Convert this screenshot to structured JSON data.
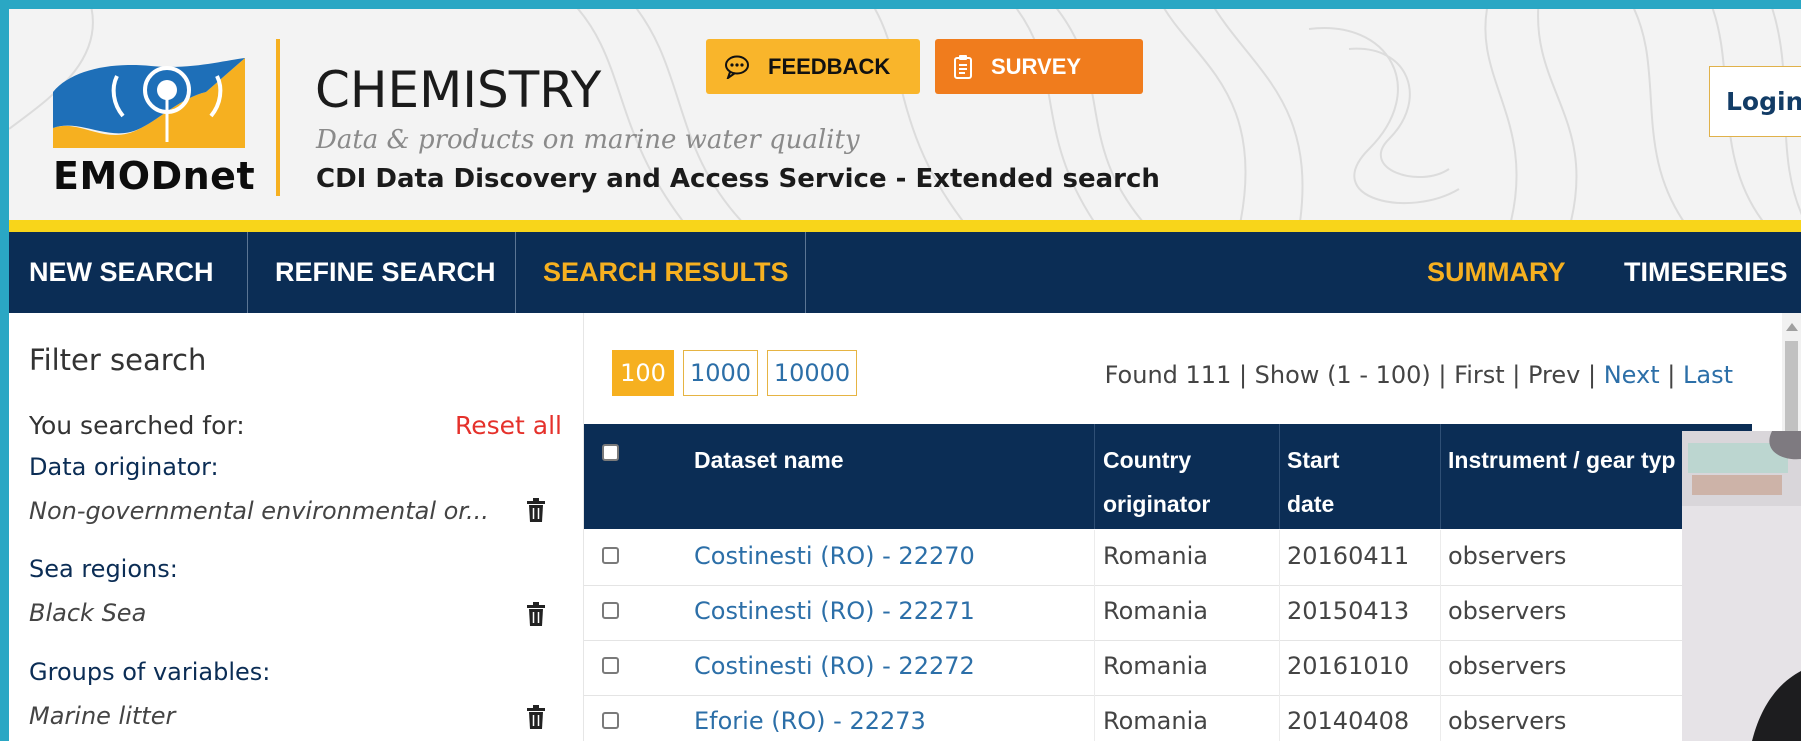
{
  "header": {
    "logo_text": "EMODnet",
    "title": "CHEMISTRY",
    "subtitle": "Data & products on marine water quality",
    "service_title": "CDI Data Discovery and Access Service - Extended search",
    "feedback_label": "FEEDBACK",
    "survey_label": "SURVEY",
    "login_label": "Login"
  },
  "colors": {
    "navy": "#0b2d55",
    "accent_orange": "#f6b020",
    "survey_orange": "#f07c1d",
    "yellow_bar": "#f8d51a",
    "link_blue": "#2c6fa8",
    "reset_red": "#e5312b"
  },
  "nav": {
    "new_search": "NEW SEARCH",
    "refine_search": "REFINE SEARCH",
    "search_results": "SEARCH RESULTS",
    "summary": "SUMMARY",
    "timeseries": "TIMESERIES"
  },
  "sidebar": {
    "title": "Filter search",
    "searched_for": "You searched for:",
    "reset_all": "Reset all",
    "filters": [
      {
        "label": "Data originator:",
        "value": "Non-governmental environmental or..."
      },
      {
        "label": "Sea regions:",
        "value": "Black Sea"
      },
      {
        "label": "Groups of variables:",
        "value": "Marine litter"
      }
    ]
  },
  "pagination": {
    "sizes": [
      "100",
      "1000",
      "10000"
    ],
    "found": "Found 111 | Show (1 - 100) | First | Prev |",
    "next": "Next",
    "bar": "|",
    "last": "Last"
  },
  "table": {
    "headers": {
      "dataset_name": "Dataset name",
      "country_1": "Country",
      "country_2": "originator",
      "start_1": "Start",
      "start_2": "date",
      "instrument": "Instrument / gear typ"
    },
    "rows": [
      {
        "name": "Costinesti (RO) - 22270",
        "country": "Romania",
        "start": "20160411",
        "instrument": "observers"
      },
      {
        "name": "Costinesti (RO) - 22271",
        "country": "Romania",
        "start": "20150413",
        "instrument": "observers"
      },
      {
        "name": "Costinesti (RO) - 22272",
        "country": "Romania",
        "start": "20161010",
        "instrument": "observers"
      },
      {
        "name": "Eforie (RO) - 22273",
        "country": "Romania",
        "start": "20140408",
        "instrument": "observers"
      }
    ]
  }
}
